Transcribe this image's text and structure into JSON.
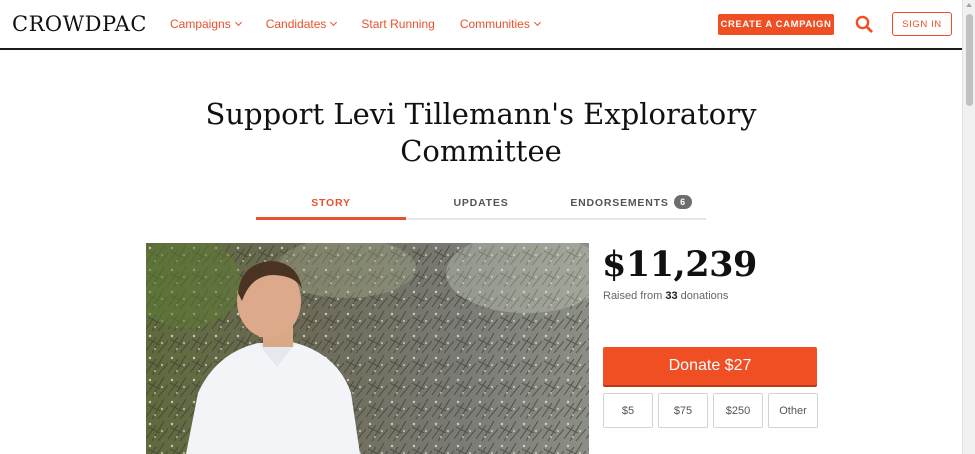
{
  "brand": {
    "logo": "CROWDPAC",
    "accent": "#f04e23"
  },
  "nav": {
    "items": [
      {
        "label": "Campaigns",
        "has_dropdown": true
      },
      {
        "label": "Candidates",
        "has_dropdown": true
      },
      {
        "label": "Start Running",
        "has_dropdown": false
      },
      {
        "label": "Communities",
        "has_dropdown": true
      }
    ],
    "create_label": "CREATE A CAMPAIGN",
    "search_icon": "search-icon",
    "signin_label": "SIGN IN"
  },
  "page": {
    "title": "Support Levi Tillemann's Exploratory Committee"
  },
  "tabs": [
    {
      "label": "STORY",
      "active": true
    },
    {
      "label": "UPDATES",
      "active": false
    },
    {
      "label": "ENDORSEMENTS",
      "active": false,
      "badge": "6"
    }
  ],
  "donation": {
    "amount": "$11,239",
    "raised_prefix": "Raised from",
    "donation_count": "33",
    "raised_suffix": "donations",
    "donate_label": "Donate $27",
    "amount_options": [
      "$5",
      "$75",
      "$250",
      "Other"
    ]
  }
}
